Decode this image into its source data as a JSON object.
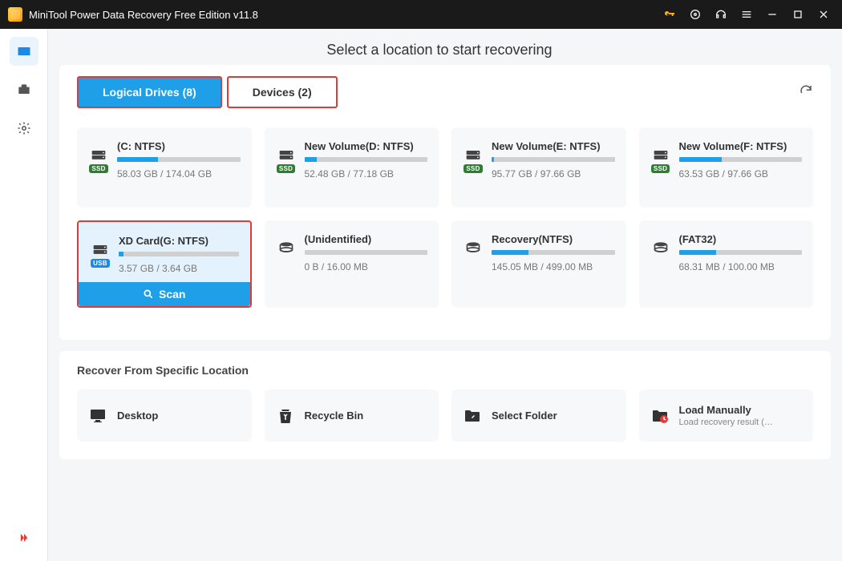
{
  "title": "MiniTool Power Data Recovery Free Edition v11.8",
  "headline": "Select a location to start recovering",
  "tabs": {
    "logical": "Logical Drives (8)",
    "devices": "Devices (2)"
  },
  "drives": [
    {
      "name": "(C: NTFS)",
      "size": "58.03 GB / 174.04 GB",
      "pct": 33,
      "badge": "SSD",
      "badgeClass": "ssd"
    },
    {
      "name": "New Volume(D: NTFS)",
      "size": "52.48 GB / 77.18 GB",
      "pct": 10,
      "badge": "SSD",
      "badgeClass": "ssd"
    },
    {
      "name": "New Volume(E: NTFS)",
      "size": "95.77 GB / 97.66 GB",
      "pct": 2,
      "badge": "SSD",
      "badgeClass": "ssd"
    },
    {
      "name": "New Volume(F: NTFS)",
      "size": "63.53 GB / 97.66 GB",
      "pct": 35,
      "badge": "SSD",
      "badgeClass": "ssd"
    },
    {
      "name": "XD Card(G: NTFS)",
      "size": "3.57 GB / 3.64 GB",
      "pct": 4,
      "badge": "USB",
      "badgeClass": "usb",
      "selected": true
    },
    {
      "name": "(Unidentified)",
      "size": "0 B / 16.00 MB",
      "pct": 0,
      "badge": "",
      "hdd": true
    },
    {
      "name": "Recovery(NTFS)",
      "size": "145.05 MB / 499.00 MB",
      "pct": 30,
      "badge": "",
      "hdd": true
    },
    {
      "name": "(FAT32)",
      "size": "68.31 MB / 100.00 MB",
      "pct": 30,
      "badge": "",
      "hdd": true
    }
  ],
  "scan_label": "Scan",
  "recover_header": "Recover From Specific Location",
  "locations": [
    {
      "icon": "desktop",
      "label": "Desktop"
    },
    {
      "icon": "recycle",
      "label": "Recycle Bin"
    },
    {
      "icon": "folder",
      "label": "Select Folder"
    },
    {
      "icon": "load",
      "label": "Load Manually",
      "sub": "Load recovery result (*...."
    }
  ]
}
